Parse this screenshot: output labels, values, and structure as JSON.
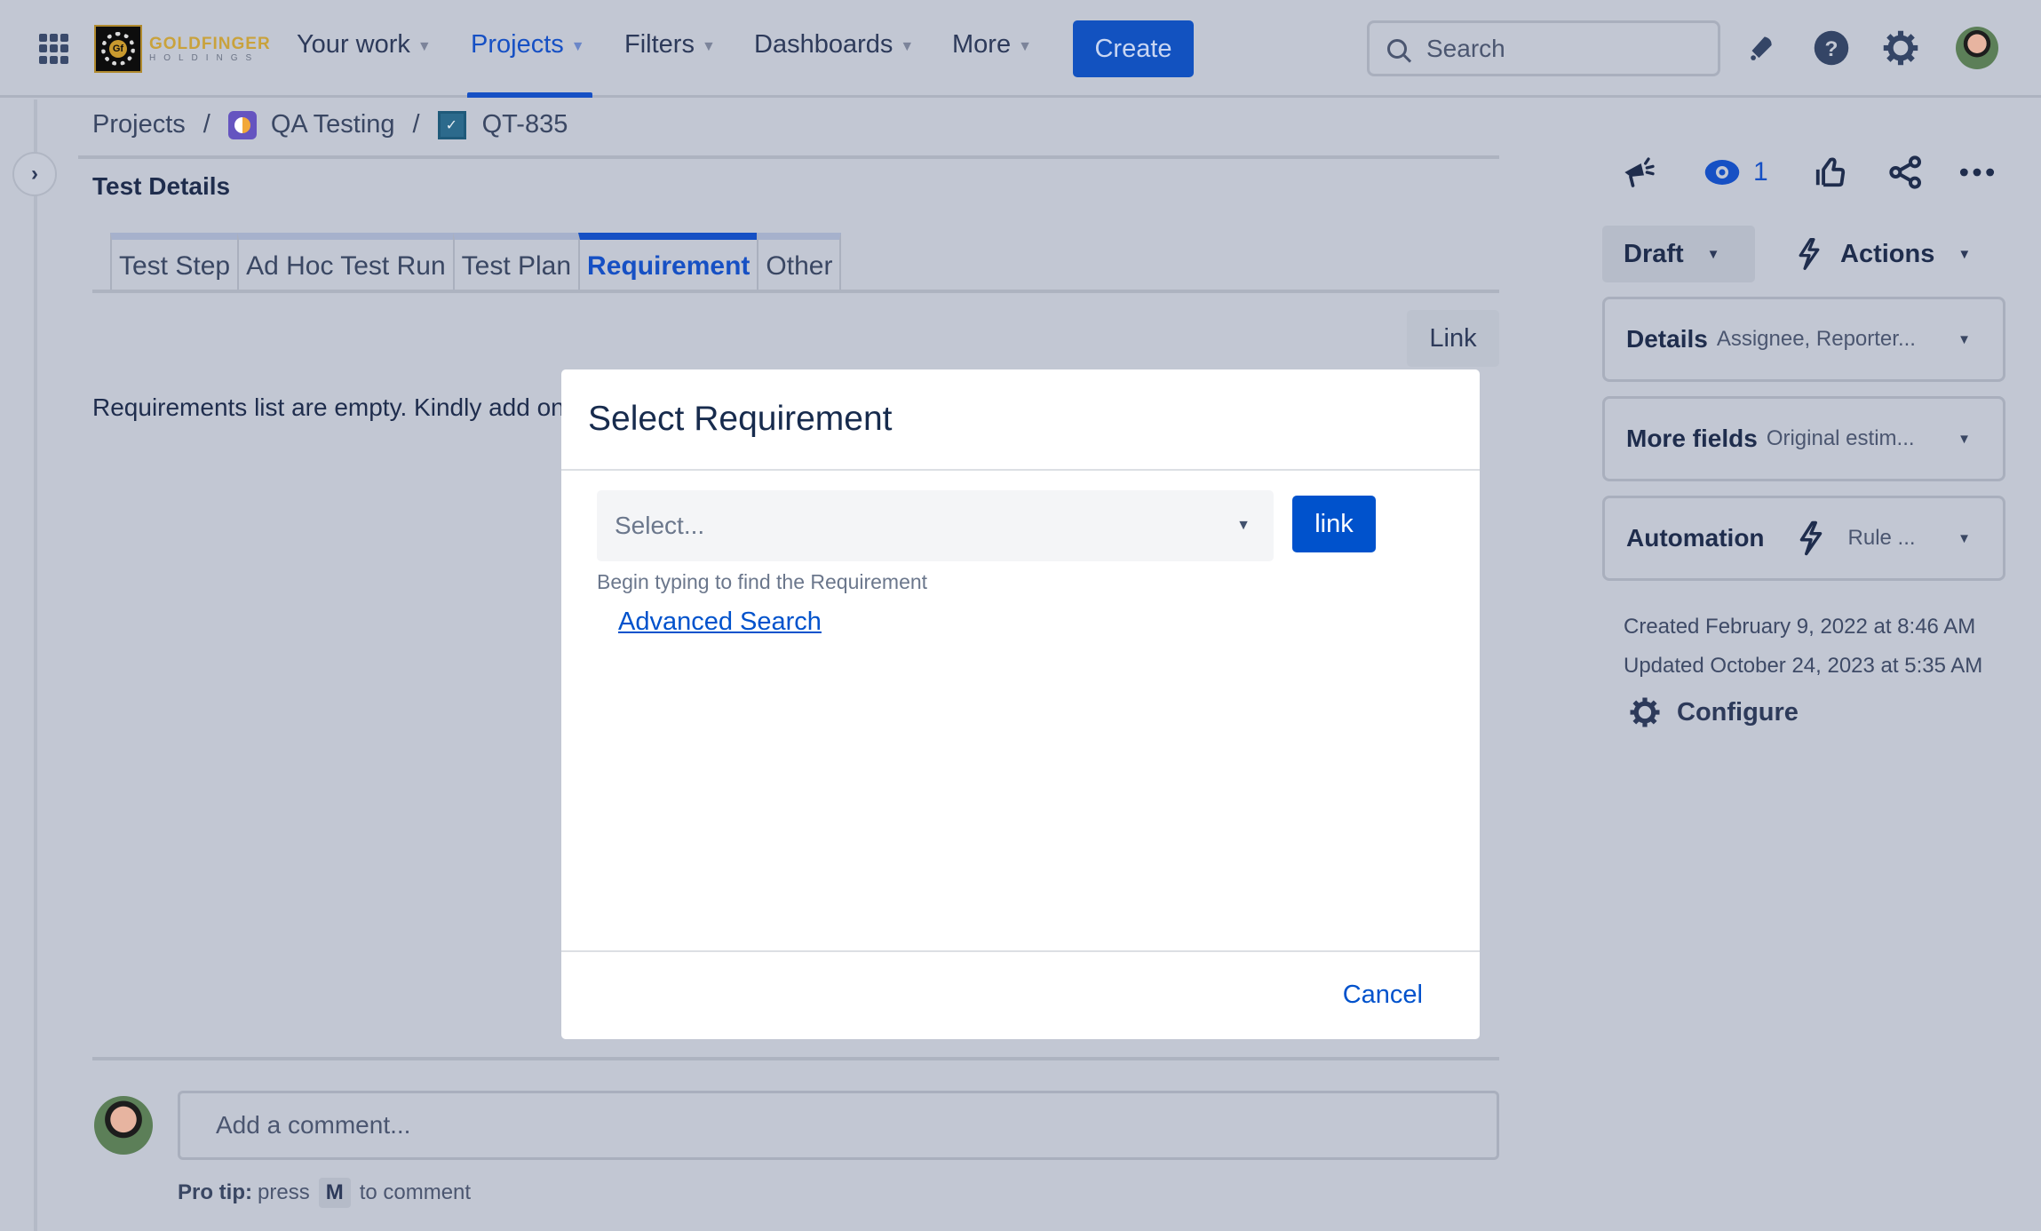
{
  "nav": {
    "brand_line1": "GOLDFINGER",
    "brand_line2": "HOLDINGS",
    "brand_mark": "Gf",
    "items": [
      {
        "label": "Your work",
        "active": false
      },
      {
        "label": "Projects",
        "active": true
      },
      {
        "label": "Filters",
        "active": false
      },
      {
        "label": "Dashboards",
        "active": false
      },
      {
        "label": "More",
        "active": false
      }
    ],
    "create_label": "Create",
    "search_placeholder": "Search",
    "icons": [
      "app-switcher-icon",
      "notifications-bell-icon",
      "help-icon",
      "settings-gear-icon",
      "user-avatar"
    ]
  },
  "breadcrumb": {
    "items": [
      "Projects",
      "QA Testing",
      "QT-835"
    ],
    "separator": "/"
  },
  "issue": {
    "section_title": "Test Details",
    "tabs": [
      {
        "label": "Test Step",
        "active": false
      },
      {
        "label": "Ad Hoc Test Run",
        "active": false
      },
      {
        "label": "Test Plan",
        "active": false
      },
      {
        "label": "Requirement",
        "active": true
      },
      {
        "label": "Other",
        "active": false
      }
    ],
    "link_button": "Link",
    "empty_message": "Requirements list are empty. Kindly add one"
  },
  "comment": {
    "placeholder": "Add a comment...",
    "protip_label": "Pro tip:",
    "protip_pre": "press",
    "protip_key": "M",
    "protip_post": "to comment"
  },
  "sidebar": {
    "watch_count": "1",
    "status": "Draft",
    "actions_label": "Actions",
    "panels": [
      {
        "title": "Details",
        "subtitle": "Assignee, Reporter..."
      },
      {
        "title": "More fields",
        "subtitle": "Original estim..."
      },
      {
        "title": "Automation",
        "subtitle": "Rule ..."
      }
    ],
    "created": "Created February 9, 2022 at 8:46 AM",
    "updated": "Updated October 24, 2023 at 5:35 AM",
    "configure_label": "Configure"
  },
  "modal": {
    "title": "Select Requirement",
    "select_placeholder": "Select...",
    "link_label": "link",
    "hint": "Begin typing to find the Requirement",
    "advanced_search": "Advanced Search",
    "cancel_label": "Cancel"
  },
  "colors": {
    "primary": "#0052cc",
    "overlay_bg": "#c2c7d3",
    "text_dark": "#172b4d"
  }
}
